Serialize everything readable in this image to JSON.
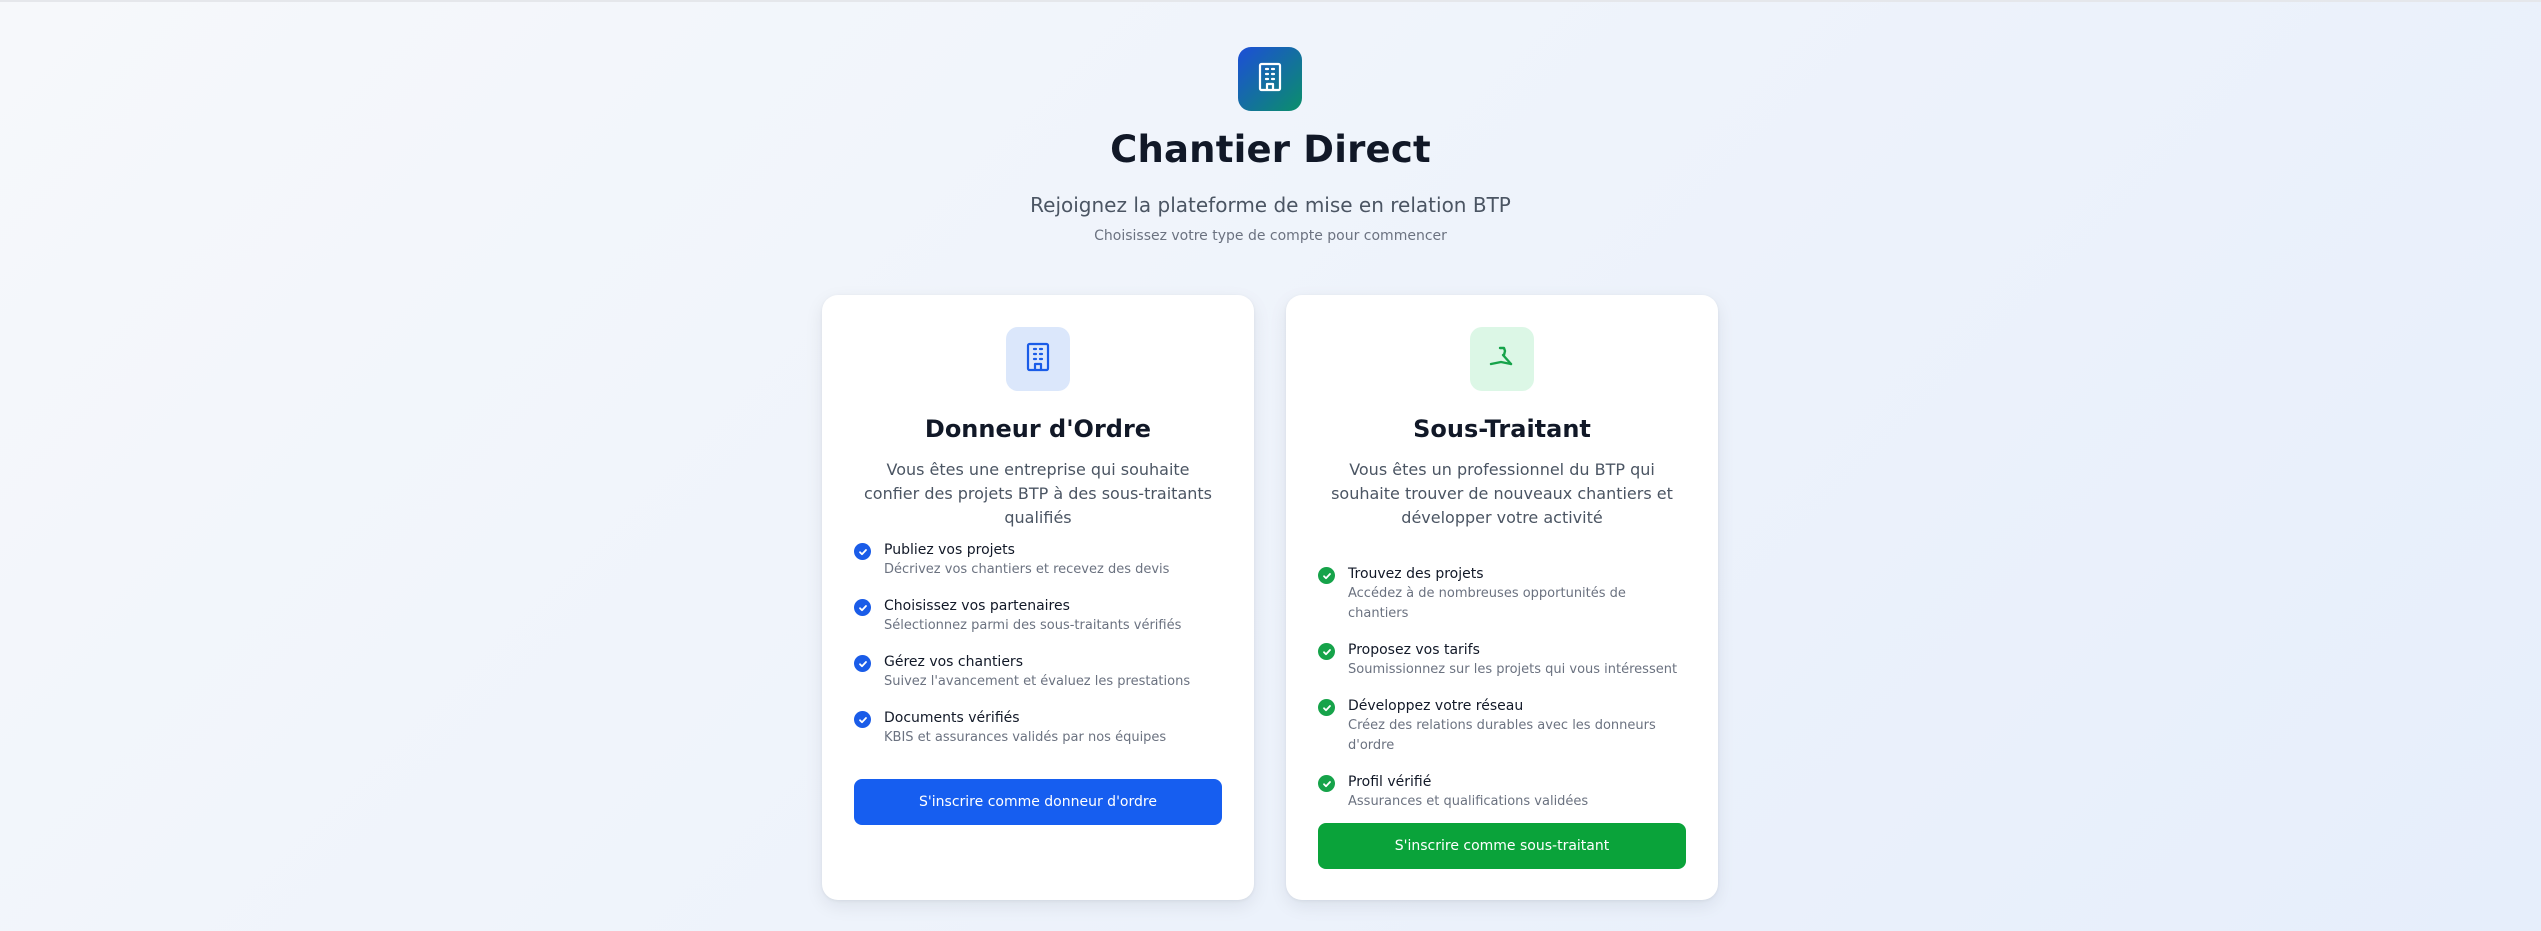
{
  "header": {
    "app_title": "Chantier Direct",
    "subtitle": "Rejoignez la plateforme de mise en relation BTP",
    "hint": "Choisissez votre type de compte pour commencer",
    "logo_icon": "building-icon"
  },
  "colors": {
    "primary_blue": "#165ef0",
    "primary_green": "#0aa33a",
    "text_dark": "#111827",
    "text_muted": "#6b7280"
  },
  "cards": [
    {
      "icon": "building-icon",
      "title": "Donneur d'Ordre",
      "description": "Vous êtes une entreprise qui souhaite confier des projets BTP à des sous-traitants qualifiés",
      "features": [
        {
          "title": "Publiez vos projets",
          "desc": "Décrivez vos chantiers et recevez des devis"
        },
        {
          "title": "Choisissez vos partenaires",
          "desc": "Sélectionnez parmi des sous-traitants vérifiés"
        },
        {
          "title": "Gérez vos chantiers",
          "desc": "Suivez l'avancement et évaluez les prestations"
        },
        {
          "title": "Documents vérifiés",
          "desc": "KBIS et assurances validés par nos équipes"
        }
      ],
      "button_label": "S'inscrire comme donneur d'ordre"
    },
    {
      "icon": "hammer-icon",
      "title": "Sous-Traitant",
      "description": "Vous êtes un professionnel du BTP qui souhaite trouver de nouveaux chantiers et développer votre activité",
      "features": [
        {
          "title": "Trouvez des projets",
          "desc": "Accédez à de nombreuses opportunités de chantiers"
        },
        {
          "title": "Proposez vos tarifs",
          "desc": "Soumissionnez sur les projets qui vous intéressent"
        },
        {
          "title": "Développez votre réseau",
          "desc": "Créez des relations durables avec les donneurs d'ordre"
        },
        {
          "title": "Profil vérifié",
          "desc": "Assurances et qualifications validées"
        }
      ],
      "button_label": "S'inscrire comme sous-traitant"
    }
  ]
}
